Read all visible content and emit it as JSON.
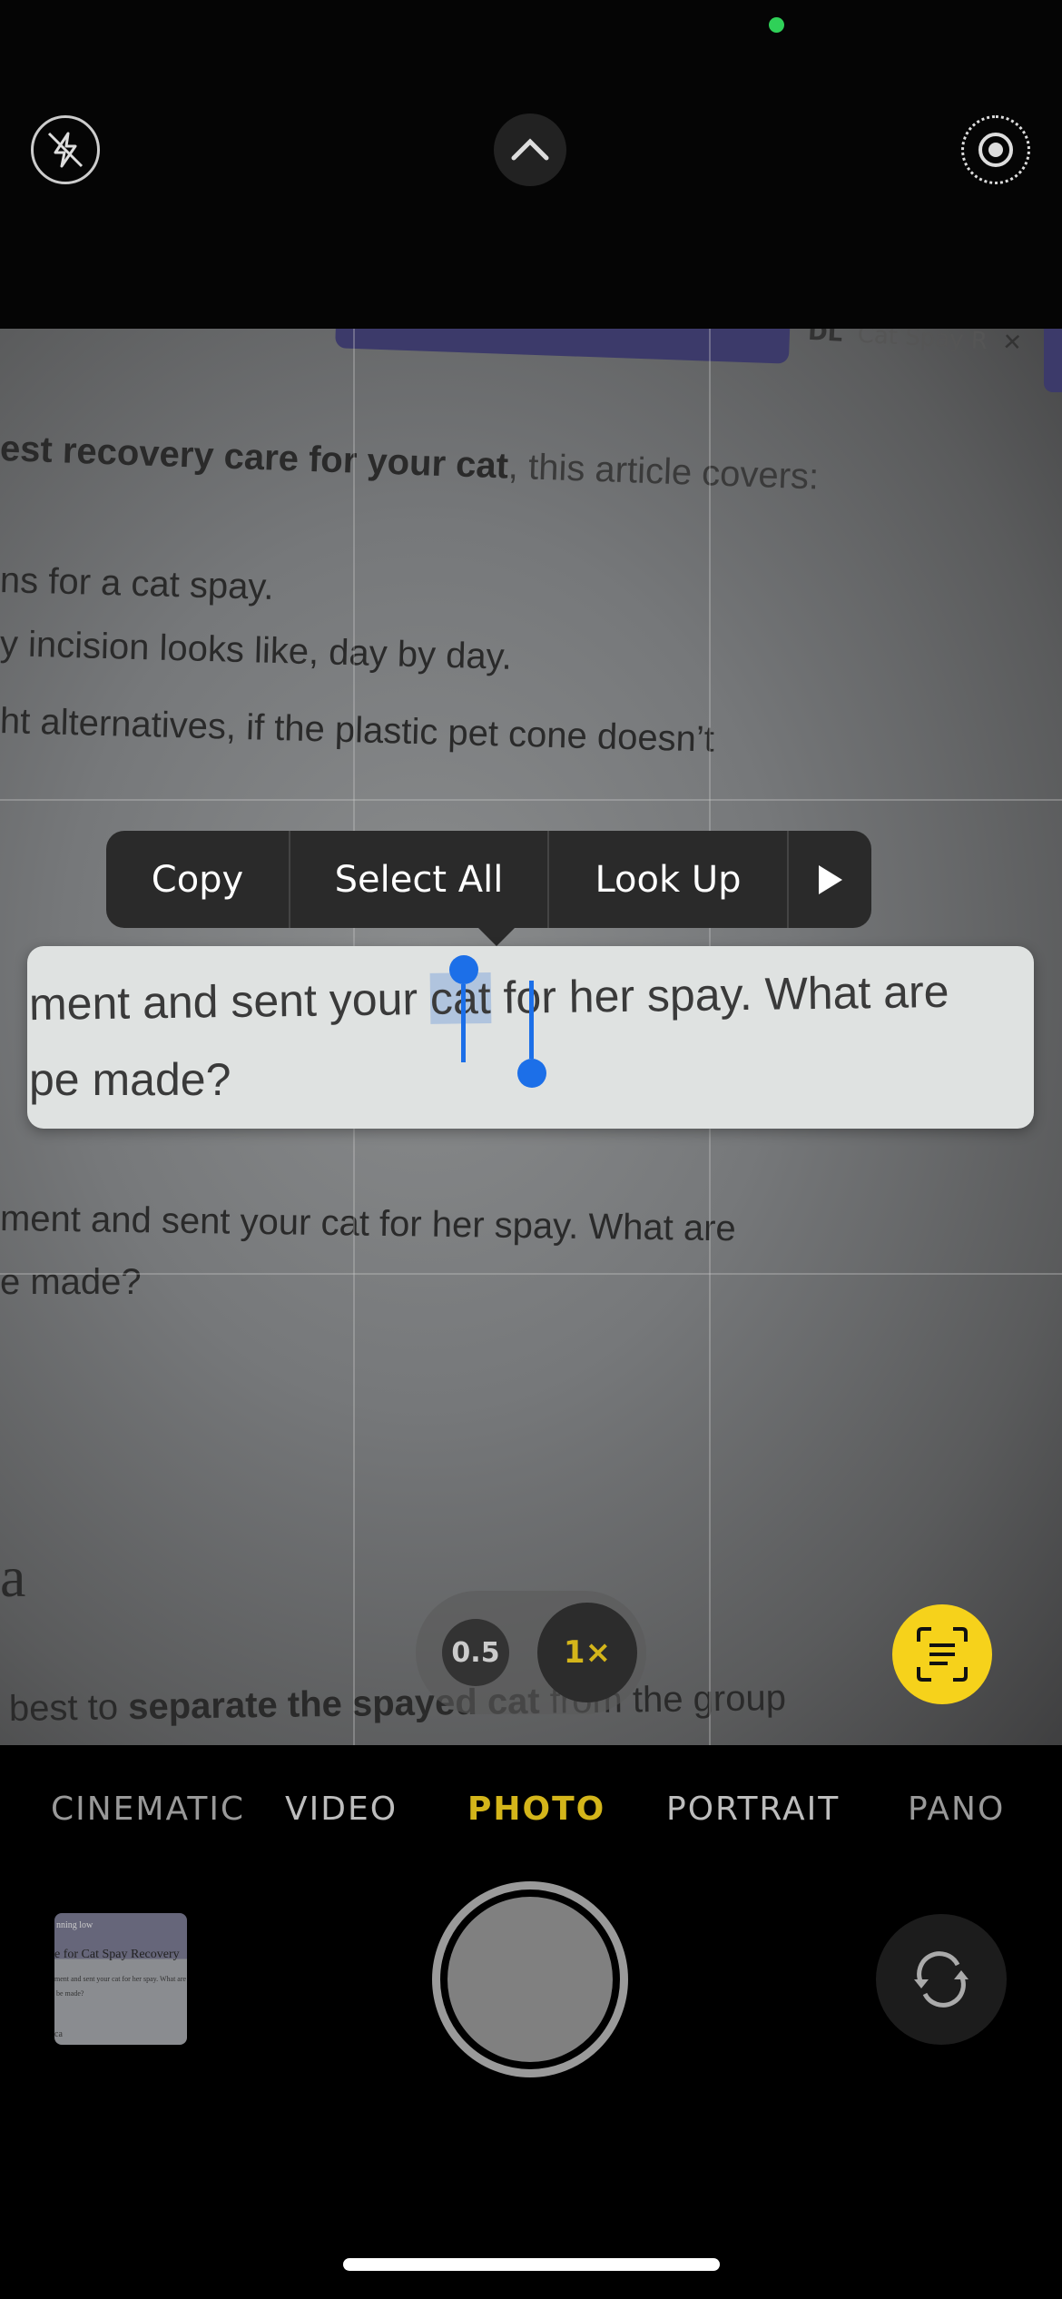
{
  "status": {
    "camera_in_use_color": "#2fd158"
  },
  "top_controls": {
    "flash": "flash-off-icon",
    "chevron": "chevron-up-icon",
    "live": "live-photo-icon"
  },
  "viewfinder": {
    "tab_title": "Cat Spay R",
    "tab_logo": "DL",
    "lines": [
      "est recovery care for your cat, this article covers:",
      "ns for a cat spay.",
      "y incision looks like, day by day.",
      "ht alternatives, if the plastic pet cone doesn’t",
      "ment and sent your cat for her spay. What are",
      "e made?",
      "a",
      "best to separate the spayed cat from the group"
    ],
    "line0_bold": "est recovery care for your cat",
    "line0_rest": ", this article covers:",
    "line7_pre": "best to ",
    "line7_bold": "separate the spayed cat",
    "line7_rest": " from the group"
  },
  "context_menu": {
    "items": [
      "Copy",
      "Select All",
      "Look Up"
    ],
    "more": "play-arrow-icon"
  },
  "live_text": {
    "line1_pre": "ment and sent your",
    "selected": "cat",
    "line1_post": "for her spay. What are",
    "line2": "pe made?",
    "selection_color": "#1c6fe8"
  },
  "zoom": {
    "options": [
      "0.5",
      "1×"
    ],
    "selected": "1×",
    "accent": "#d4b51a"
  },
  "live_text_button": {
    "icon": "live-text-scan-icon",
    "color": "#f6d21b"
  },
  "modes": {
    "items": [
      "CINEMATIC",
      "VIDEO",
      "PHOTO",
      "PORTRAIT",
      "PANO"
    ],
    "selected": "PHOTO",
    "selected_color": "#d4b51a"
  },
  "thumbnail": {
    "lines": [
      "nning low",
      "e for Cat Spay Recovery",
      "ment and sent your cat for her spay. What are",
      "be made?",
      "ca"
    ]
  },
  "flip_camera": {
    "icon": "flip-camera-icon"
  }
}
